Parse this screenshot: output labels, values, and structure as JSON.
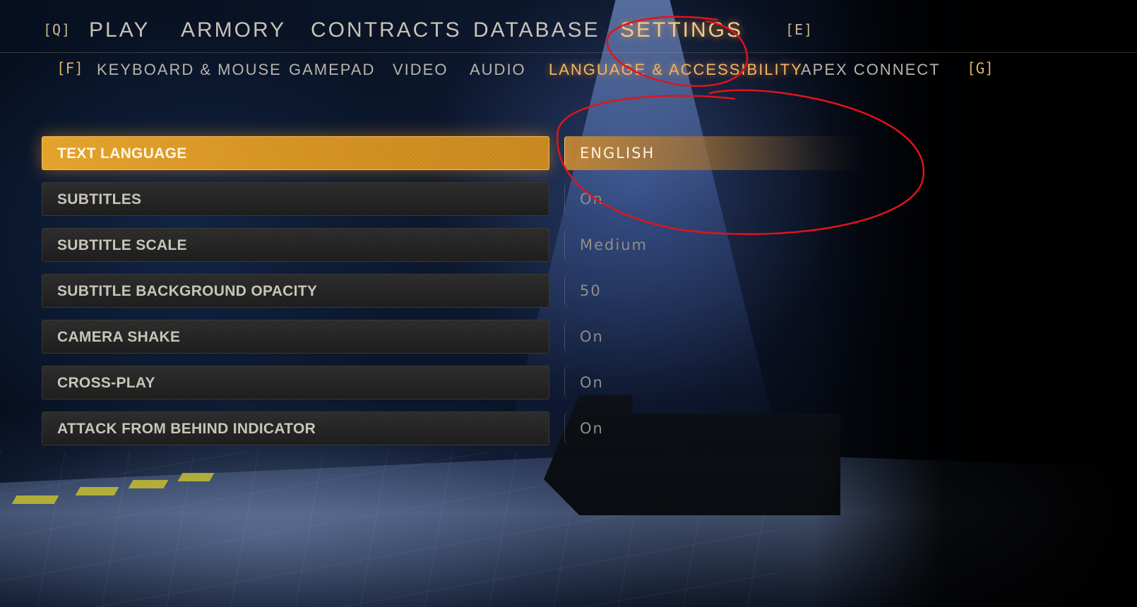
{
  "top_nav": {
    "left_key": "[Q]",
    "right_key": "[E]",
    "tabs": [
      {
        "label": "PLAY"
      },
      {
        "label": "ARMORY"
      },
      {
        "label": "CONTRACTS"
      },
      {
        "label": "DATABASE"
      },
      {
        "label": "SETTINGS"
      }
    ],
    "active_tab": "SETTINGS"
  },
  "sub_nav": {
    "left_key": "[F]",
    "right_key": "[G]",
    "tabs": [
      {
        "label": "KEYBOARD & MOUSE"
      },
      {
        "label": "GAMEPAD"
      },
      {
        "label": "VIDEO"
      },
      {
        "label": "AUDIO"
      },
      {
        "label": "LANGUAGE & ACCESSIBILITY"
      },
      {
        "label": "APEX CONNECT"
      }
    ],
    "active_tab": "LANGUAGE & ACCESSIBILITY"
  },
  "settings": [
    {
      "label": "TEXT LANGUAGE",
      "value": "ENGLISH"
    },
    {
      "label": "SUBTITLES",
      "value": "On"
    },
    {
      "label": "SUBTITLE SCALE",
      "value": "Medium"
    },
    {
      "label": "SUBTITLE BACKGROUND OPACITY",
      "value": "50"
    },
    {
      "label": "CAMERA SHAKE",
      "value": "On"
    },
    {
      "label": "CROSS-PLAY",
      "value": "On"
    },
    {
      "label": "ATTACK FROM BEHIND INDICATOR",
      "value": "On"
    }
  ],
  "selected_setting": "TEXT LANGUAGE",
  "colors": {
    "accent": "#e3a128",
    "active_text": "#f0c98a",
    "annotation": "#e0141a"
  }
}
